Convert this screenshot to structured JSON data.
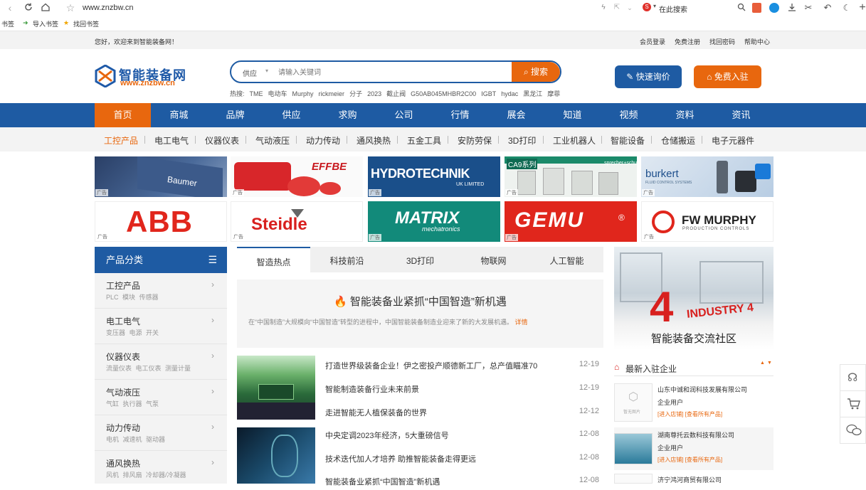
{
  "browser": {
    "url": "www.znzbw.cn",
    "search_engine_placeholder": "在此搜索",
    "bookmarks": {
      "label": "书签",
      "import": "导入书签",
      "find": "找回书签"
    }
  },
  "topbar": {
    "welcome": "您好，欢迎来到智能装备网！",
    "links": [
      "会员登录",
      "免费注册",
      "找回密码",
      "帮助中心"
    ]
  },
  "header": {
    "logo_name": "智能装备网",
    "logo_url": "www.znzbw.cn",
    "search_type": "供应",
    "search_placeholder": "请输入关键词",
    "search_button": "搜索",
    "hot_label": "热搜:",
    "hot_words": [
      "TME",
      "电动车",
      "Murphy",
      "rickmeier",
      "分子",
      "2023",
      "截止阀",
      "G50AB045MHBR2C00",
      "IGBT",
      "hydac",
      "黑龙江",
      "摩菲"
    ],
    "inquiry_button": "快速询价",
    "join_button": "免费入驻"
  },
  "main_nav": [
    "首页",
    "商城",
    "品牌",
    "供应",
    "求购",
    "公司",
    "行情",
    "展会",
    "知道",
    "视频",
    "资料",
    "资讯"
  ],
  "sub_nav": [
    "工控产品",
    "电工电气",
    "仪器仪表",
    "气动液压",
    "动力传动",
    "通风换热",
    "五金工具",
    "安防劳保",
    "3D打印",
    "工业机器人",
    "智能设备",
    "仓储搬运",
    "电子元器件"
  ],
  "ads": {
    "tag": "广告",
    "row1": [
      "Baumer",
      "EFFBE",
      "HYDROTECHNIK",
      "CA9系列",
      "burkert"
    ],
    "row1_sub": [
      "",
      "",
      "UK LIMITED",
      "sprecher+schuh",
      "FLUID CONTROL SYSTEMS"
    ],
    "row2": [
      "ABB",
      "Steidle",
      "MATRIX",
      "GEMU",
      "FW MURPHY"
    ],
    "row2_sub": [
      "",
      "",
      "mechatronics",
      "®",
      "PRODUCTION CONTROLS"
    ]
  },
  "categories": {
    "title": "产品分类",
    "items": [
      {
        "title": "工控产品",
        "sub": "PLC 模块 传感器"
      },
      {
        "title": "电工电气",
        "sub": "变压器 电源 开关"
      },
      {
        "title": "仪器仪表",
        "sub": "流量仪表 电工仪表 测量计量"
      },
      {
        "title": "气动液压",
        "sub": "气缸 执行器 气泵"
      },
      {
        "title": "动力传动",
        "sub": "电机 减速机 驱动器"
      },
      {
        "title": "通风换热",
        "sub": "风机 排风扇 冷却器/冷凝器"
      }
    ]
  },
  "tabs": [
    "智造热点",
    "科技前沿",
    "3D打印",
    "物联网",
    "人工智能"
  ],
  "feature": {
    "title": "智能装备业紧抓“中国智造”新机遇",
    "desc": "在“中国制造”大规模向“中国智造”转型的进程中，中国智能装备制造业迎来了新的大发展机遇。",
    "more": "详情"
  },
  "news": [
    {
      "title": "打造世界级装备企业！伊之密投产顺德新工厂，总产值瞄准70",
      "date": "12-19"
    },
    {
      "title": "智能制造装备行业未来前景",
      "date": "12-19"
    },
    {
      "title": "走进智能无人植保装备的世界",
      "date": "12-12"
    },
    {
      "title": "中央定调2023年经济，5大重磅信号",
      "date": "12-08"
    },
    {
      "title": "技术迭代加人才培养 助推智能装备走得更远",
      "date": "12-08"
    },
    {
      "title": "智能装备业紧抓“中国智造”新机遇",
      "date": "12-08"
    }
  ],
  "promo": {
    "caption": "智能装备交流社区",
    "image_text": "INDUSTRY 4"
  },
  "new_companies": {
    "title": "最新入驻企业",
    "placeholder_img": "暂无图片",
    "items": [
      {
        "name": "山东中诚和润科技发展有限公司",
        "type": "企业用户",
        "shop": "[进入店铺]",
        "products": "[查看所有产品]"
      },
      {
        "name": "湖南尊托云数科技有限公司",
        "type": "企业用户",
        "shop": "[进入店铺]",
        "products": "[查看所有产品]"
      },
      {
        "name": "济宁鸿河商贸有限公司",
        "type": "",
        "shop": "",
        "products": ""
      }
    ]
  },
  "colors": {
    "primary": "#1e5ba3",
    "accent": "#e8670e"
  }
}
